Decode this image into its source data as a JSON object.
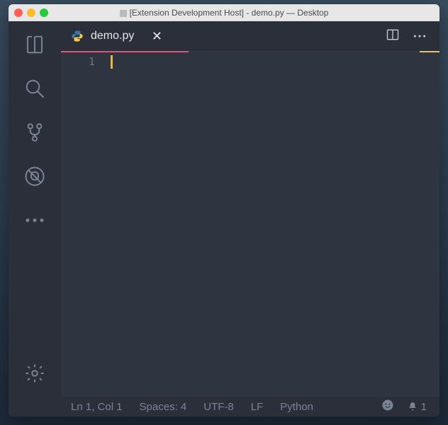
{
  "titlebar": {
    "title": "[Extension Development Host] - demo.py — Desktop"
  },
  "tabs": {
    "active": {
      "label": "demo.py",
      "icon": "python-icon"
    }
  },
  "editor": {
    "line_numbers": [
      "1"
    ]
  },
  "statusbar": {
    "cursor": "Ln 1, Col 1",
    "spaces": "Spaces: 4",
    "encoding": "UTF-8",
    "eol": "LF",
    "language": "Python",
    "notifications": "1"
  }
}
